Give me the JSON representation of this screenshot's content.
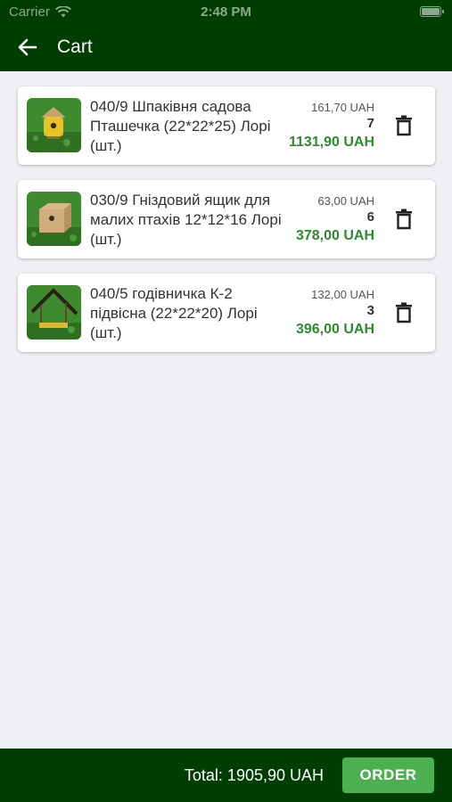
{
  "status_bar": {
    "carrier": "Carrier",
    "time": "2:48 PM"
  },
  "nav": {
    "title": "Cart",
    "back_icon": "arrow-left-icon"
  },
  "items": [
    {
      "name": "040/9 Шпаківня садова Пташечка (22*22*25) Лорі (шт.)",
      "unit_price": "161,70 UAH",
      "quantity": "7",
      "total": "1131,90 UAH",
      "image": "birdhouse-yellow"
    },
    {
      "name": "030/9 Гніздовий ящик для малих птахів 12*12*16 Лорі (шт.)",
      "unit_price": "63,00 UAH",
      "quantity": "6",
      "total": "378,00 UAH",
      "image": "nest-box-wood"
    },
    {
      "name": "040/5 годівничка К-2 підвісна (22*22*20) Лорі (шт.)",
      "unit_price": "132,00 UAH",
      "quantity": "3",
      "total": "396,00 UAH",
      "image": "hanging-feeder"
    }
  ],
  "footer": {
    "total_label": "Total: 1905,90 UAH",
    "order_label": "ORDER"
  },
  "colors": {
    "header_bg": "#003d00",
    "accent_green": "#2e8b2e",
    "order_button": "#4caf50"
  }
}
